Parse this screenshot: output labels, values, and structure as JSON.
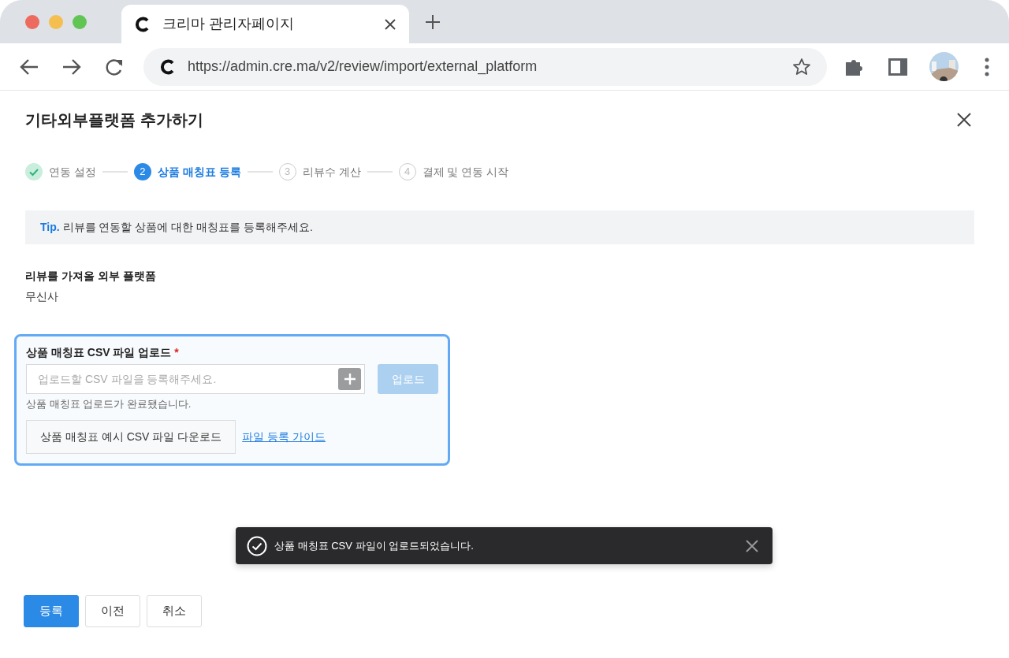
{
  "browser": {
    "tab_title": "크리마 관리자페이지",
    "url": "https://admin.cre.ma/v2/review/import/external_platform"
  },
  "page": {
    "title": "기타외부플랫폼 추가하기"
  },
  "steps": [
    {
      "label": "연동 설정",
      "completed": true,
      "selected": false
    },
    {
      "number": "2",
      "label": "상품 매칭표 등록",
      "completed": false,
      "selected": true
    },
    {
      "number": "3",
      "label": "리뷰수 계산",
      "completed": false,
      "selected": false
    },
    {
      "number": "4",
      "label": "결제 및 연동 시작",
      "completed": false,
      "selected": false
    }
  ],
  "tip": {
    "lead": "Tip.",
    "text": "리뷰를 연동할 상품에 대한 매칭표를 등록해주세요."
  },
  "platform": {
    "label": "리뷰를 가져올 외부 플랫폼",
    "value": "무신사"
  },
  "upload": {
    "label": "상품 매칭표 CSV 파일 업로드",
    "required_mark": "*",
    "placeholder": "업로드할 CSV 파일을 등록해주세요.",
    "upload_button": "업로드",
    "upload_disabled": true,
    "help": "상품 매칭표 업로드가 완료됐습니다.",
    "sample_button": "상품 매칭표 예시 CSV 파일 다운로드",
    "guide_link": "파일 등록 가이드"
  },
  "toast": {
    "message": "상품 매칭표 CSV 파일이 업로드되었습니다."
  },
  "footer_buttons": [
    {
      "label": "등록",
      "kind": "primary"
    },
    {
      "label": "이전",
      "kind": "secondary"
    },
    {
      "label": "취소",
      "kind": "secondary"
    }
  ]
}
